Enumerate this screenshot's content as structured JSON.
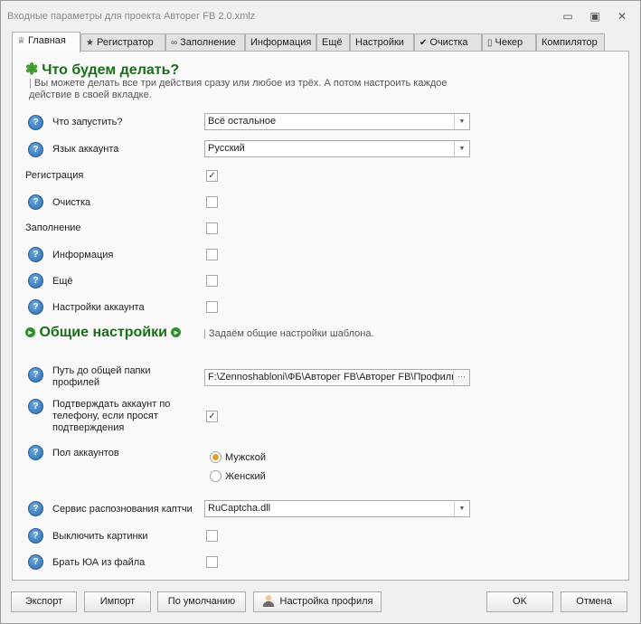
{
  "window": {
    "title": "Входные параметры для проекта Авторег FB 2.0.xmlz",
    "controls": {
      "minimize": "▭",
      "maximize": "▣",
      "close": "✕"
    }
  },
  "tabs": [
    {
      "label": "Главная",
      "icon": "home-icon",
      "glyph": "♕",
      "active": true
    },
    {
      "label": "Регистратор",
      "icon": "star-icon",
      "glyph": "★"
    },
    {
      "label": "Заполнение",
      "icon": "infinity-icon",
      "glyph": "∞"
    },
    {
      "label": "Информация"
    },
    {
      "label": "Ещё"
    },
    {
      "label": "Настройки"
    },
    {
      "label": "Очистка",
      "icon": "check-icon",
      "glyph": "✔"
    },
    {
      "label": "Чекер",
      "icon": "phone-icon",
      "glyph": "▯"
    },
    {
      "label": "Компилятор"
    }
  ],
  "main": {
    "heading": "Что будем делать?",
    "heading_icon": "gear-green-icon",
    "description": "Вы можете делать все три действия сразу или любое из трёх. А потом настроить каждое действие в своей вкладке.",
    "what_to_run": {
      "label": "Что запустить?",
      "value": "Всё остальное"
    },
    "account_language": {
      "label": "Язык аккаунта",
      "value": "Русский"
    },
    "registration": {
      "label": "Регистрация",
      "checked": true
    },
    "cleanup": {
      "label": "Очистка",
      "checked": false
    },
    "filling": {
      "label": "Заполнение",
      "checked": false
    },
    "information": {
      "label": "Информация",
      "checked": false
    },
    "more": {
      "label": "Ещё",
      "checked": false
    },
    "account_settings": {
      "label": "Настройки аккаунта",
      "checked": false
    }
  },
  "general": {
    "heading": "Общие настройки",
    "description": "Задаём общие настройки шаблона.",
    "profiles_path": {
      "label": "Путь до общей папки профилей",
      "value": "F:\\Zennoshabloni\\ФБ\\Авторег FB\\Авторег FB\\Профили"
    },
    "phone_confirm": {
      "label": "Подтверждать аккаунт по телефону, если просят подтверждения",
      "checked": true
    },
    "gender": {
      "label": "Пол аккаунтов",
      "options": [
        "Мужской",
        "Женский"
      ],
      "selected": "Мужской"
    },
    "captcha_service": {
      "label": "Сервис распознования каптчи",
      "value": "RuCaptcha.dll"
    },
    "disable_images": {
      "label": "Выключить картинки",
      "checked": false
    },
    "ua_from_file": {
      "label": "Брать ЮА из файла",
      "checked": false
    }
  },
  "footer": {
    "export": "Экспорт",
    "import": "Импорт",
    "defaults": "По умолчанию",
    "profile_settings": "Настройка профиля",
    "ok": "OK",
    "cancel": "Отмена"
  },
  "colors": {
    "heading_green": "#1a6e1a",
    "help_blue": "#2a6cb0",
    "radio_selected": "#e0a020"
  }
}
